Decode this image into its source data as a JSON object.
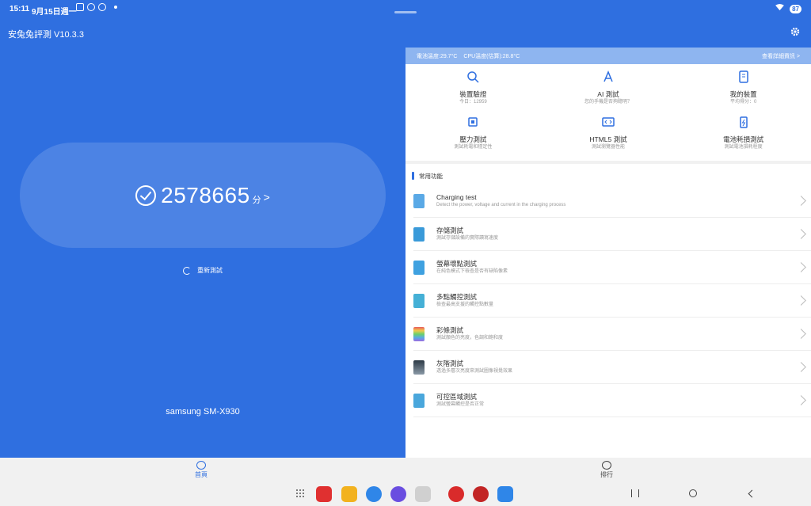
{
  "statusbar": {
    "time": "15:11",
    "date": "9月15日週一",
    "battery": "87"
  },
  "app": {
    "title": "安兔兔評測 V10.3.3"
  },
  "score": {
    "value": "2578665",
    "unit": "分",
    "arrow": ">"
  },
  "retest": {
    "label": "重新測試"
  },
  "device": {
    "name": "samsung SM-X930"
  },
  "info_bar": {
    "battery_temp": "電池溫度:29.7°C",
    "cpu_temp": "CPU溫度(估算):28.8°C",
    "link": "查看詳細資訊 >"
  },
  "grid": [
    {
      "title": "裝置驗證",
      "sub": "今日：12959",
      "icon": "magnifier-icon"
    },
    {
      "title": "AI 測試",
      "sub": "您的手機是否夠聰明？",
      "icon": "ai-icon"
    },
    {
      "title": "我的裝置",
      "sub": "平均得分：0",
      "icon": "device-icon"
    },
    {
      "title": "壓力測試",
      "sub": "測試耗電和穩定性",
      "icon": "chip-icon"
    },
    {
      "title": "HTML5 測試",
      "sub": "測試瀏覽器性能",
      "icon": "html5-icon"
    },
    {
      "title": "電池耗損測試",
      "sub": "測試電池損耗程度",
      "icon": "battery-icon"
    }
  ],
  "section": {
    "title": "常用功能"
  },
  "list": [
    {
      "title": "Charging test",
      "sub": "Detect the power, voltage and current in the charging process",
      "color": "#5aa9e6"
    },
    {
      "title": "存儲測試",
      "sub": "測試存儲設備的實際讀寫速度",
      "color": "#3a9ad9"
    },
    {
      "title": "螢幕壞點測試",
      "sub": "在純色模式下檢查是否有缺陷像素",
      "color": "#3fa1e0"
    },
    {
      "title": "多點觸控測試",
      "sub": "檢查最高支援的觸控點數量",
      "color": "#45b0d6"
    },
    {
      "title": "彩條測試",
      "sub": "測試顏色的亮度，色調和飽和度",
      "color": "#d6a04a"
    },
    {
      "title": "灰階測試",
      "sub": "透過多層次亮度來測試圖像視覺效果",
      "color": "#2d3a46"
    },
    {
      "title": "可控區域測試",
      "sub": "測試螢幕觸控是否正常",
      "color": "#4aa7dc"
    }
  ],
  "nav": {
    "home": "首頁",
    "rank": "排行"
  },
  "taskbar_apps": [
    {
      "name": "notes-app",
      "color": "#e03030"
    },
    {
      "name": "files-app",
      "color": "#f2b21f"
    },
    {
      "name": "messages-app",
      "color": "#2f86e8"
    },
    {
      "name": "internet-app",
      "color": "#6a4ee0"
    },
    {
      "name": "camera-app",
      "color": "#d0d0d0"
    },
    {
      "name": "antutu-app",
      "color": "#d92b2b"
    },
    {
      "name": "antutu3d-app",
      "color": "#c22525"
    },
    {
      "name": "store-app",
      "color": "#2f86e8"
    }
  ]
}
